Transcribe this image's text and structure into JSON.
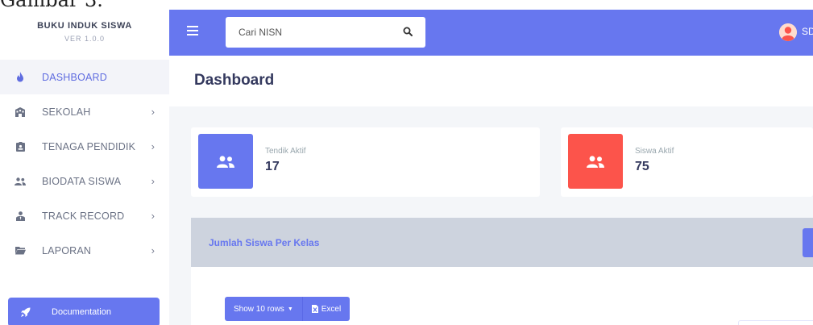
{
  "caption": "Gambar 3.",
  "brand": {
    "title": "BUKU INDUK SISWA",
    "version": "VER 1.0.0"
  },
  "sidebar": {
    "items": [
      {
        "label": "DASHBOARD",
        "icon": "fire-icon",
        "active": true
      },
      {
        "label": "SEKOLAH",
        "icon": "school-icon"
      },
      {
        "label": "TENAGA PENDIDIK",
        "icon": "id-card-icon"
      },
      {
        "label": "BIODATA SISWA",
        "icon": "users-icon"
      },
      {
        "label": "TRACK RECORD",
        "icon": "user-tie-icon"
      },
      {
        "label": "LAPORAN",
        "icon": "folder-icon"
      }
    ],
    "doc_button": "Documentation"
  },
  "topbar": {
    "search_placeholder": "Cari NISN",
    "user_name": "SD"
  },
  "page": {
    "title": "Dashboard"
  },
  "stats": [
    {
      "label": "Tendik Aktif",
      "value": "17",
      "color": "#6777ef"
    },
    {
      "label": "Siswa Aktif",
      "value": "75",
      "color": "#fc544b"
    }
  ],
  "panel": {
    "title": "Jumlah Siswa Per Kelas",
    "show_rows": "Show 10 rows",
    "excel": "Excel"
  },
  "colors": {
    "primary": "#6777ef",
    "danger": "#fc544b",
    "sidebar_active_bg": "#f3f4f9"
  }
}
